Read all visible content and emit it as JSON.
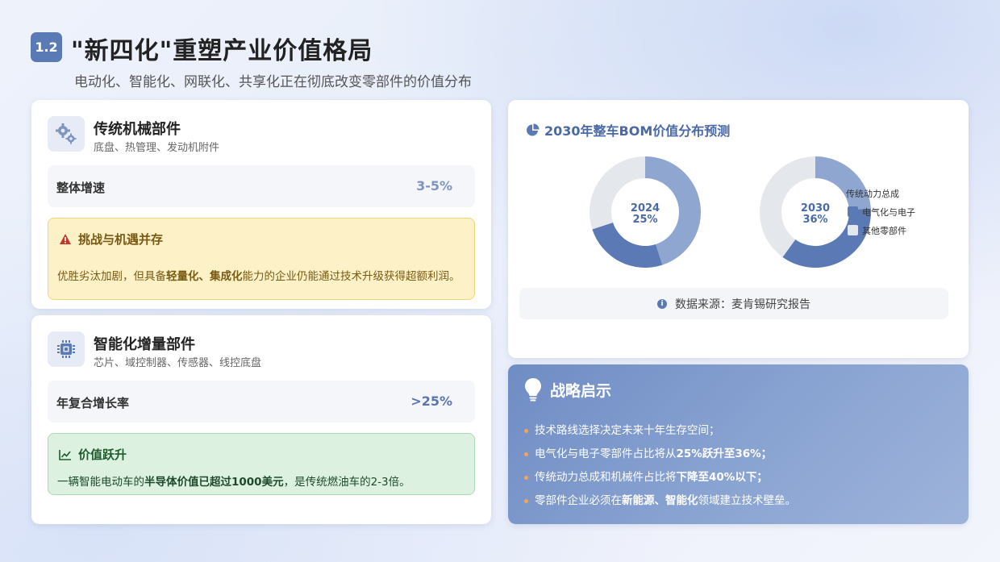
{
  "header": {
    "badge": "1.2",
    "title": "\"新四化\"重塑产业价值格局",
    "subtitle": "电动化、智能化、网联化、共享化正在彻底改变零部件的价值分布"
  },
  "traditional": {
    "icon": "gears-icon",
    "title": "传统机械部件",
    "subtitle": "底盘、热管理、发动机附件",
    "metric_label": "整体增速",
    "metric_value": "3-5%",
    "note_title": "挑战与机遇并存",
    "note_pre": "优胜劣汰加剧，但具备",
    "note_bold": "轻量化、集成化",
    "note_post": "能力的企业仍能通过技术升级获得超额利润。"
  },
  "smart": {
    "icon": "chip-icon",
    "title": "智能化增量部件",
    "subtitle": "芯片、域控制器、传感器、线控底盘",
    "metric_label": "年复合增长率",
    "metric_value": ">25%",
    "note_title": "价值跃升",
    "note_pre": "一辆智能电动车的",
    "note_bold": "半导体价值已超过1000美元",
    "note_post": "，是传统燃油车的2-3倍。"
  },
  "chart_panel": {
    "title": "2030年整车BOM价值分布预测",
    "source_label": "数据来源：麦肯锡研究报告"
  },
  "chart_data": {
    "type": "pie",
    "variant": "donut",
    "legend_position": "right",
    "series_names": [
      "传统动力总成",
      "电气化与电子",
      "其他零部件"
    ],
    "colors": [
      "#8fa6d1",
      "#5b7ab5",
      "#e4e7ec"
    ],
    "donuts": [
      {
        "center_year": "2024",
        "center_value": "25%",
        "values": [
          45,
          25,
          30
        ]
      },
      {
        "center_year": "2030",
        "center_value": "36%",
        "values": [
          24,
          36,
          40
        ]
      }
    ]
  },
  "strategy": {
    "title": "战略启示",
    "items": [
      {
        "pre": "技术路线选择决定未来十年生存空间；",
        "bold": "",
        "post": ""
      },
      {
        "pre": "电气化与电子零部件占比将从",
        "bold": "25%跃升至36%；",
        "post": ""
      },
      {
        "pre": "传统动力总成和机械件占比将",
        "bold": "下降至40%以下；",
        "post": ""
      },
      {
        "pre": "零部件企业必须在",
        "bold": "新能源、智能化",
        "post": "领域建立技术壁垒。"
      }
    ]
  }
}
